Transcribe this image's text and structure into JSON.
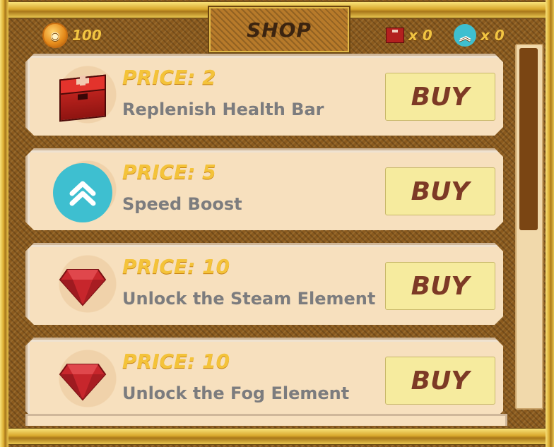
{
  "header": {
    "title": "SHOP",
    "coins": "100",
    "health_count": "x 0",
    "speed_count": "x 0"
  },
  "items": [
    {
      "price": "PRICE: 2",
      "description": "Replenish Health Bar",
      "button": "BUY",
      "icon": "health-kit-icon"
    },
    {
      "price": "PRICE: 5",
      "description": "Speed Boost",
      "button": "BUY",
      "icon": "speed-boost-icon"
    },
    {
      "price": "PRICE: 10",
      "description": "Unlock the Steam Element",
      "button": "BUY",
      "icon": "red-gem-icon"
    },
    {
      "price": "PRICE: 10",
      "description": "Unlock the Fog Element",
      "button": "BUY",
      "icon": "red-gem-icon"
    }
  ],
  "colors": {
    "price": "#f4c33a",
    "description": "#7c7c7e",
    "buy_bg": "#f6eb9e",
    "buy_text": "#7d3a26",
    "speed": "#3ebfd0",
    "gem": "#c7262c"
  }
}
